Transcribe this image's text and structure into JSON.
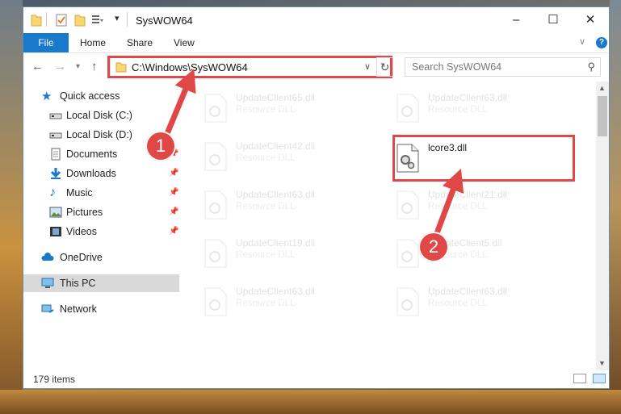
{
  "window": {
    "title": "SysWOW64",
    "controls": {
      "minimize": "–",
      "maximize": "☐",
      "close": "✕"
    }
  },
  "ribbon": {
    "file": "File",
    "tabs": [
      "Home",
      "Share",
      "View"
    ],
    "help": "?"
  },
  "address": {
    "path": "C:\\Windows\\SysWOW64",
    "search_placeholder": "Search SysWOW64"
  },
  "sidebar": {
    "items": [
      {
        "label": "Quick access",
        "icon": "star-icon",
        "pinned": false
      },
      {
        "label": "Local Disk (C:)",
        "icon": "drive-icon",
        "pinned": false
      },
      {
        "label": "Local Disk (D:)",
        "icon": "drive-icon",
        "pinned": false
      },
      {
        "label": "Documents",
        "icon": "documents-icon",
        "pinned": true
      },
      {
        "label": "Downloads",
        "icon": "download-icon",
        "pinned": true
      },
      {
        "label": "Music",
        "icon": "music-icon",
        "pinned": true
      },
      {
        "label": "Pictures",
        "icon": "pictures-icon",
        "pinned": true
      },
      {
        "label": "Videos",
        "icon": "videos-icon",
        "pinned": true
      },
      {
        "label": "OneDrive",
        "icon": "cloud-icon",
        "pinned": false
      },
      {
        "label": "This PC",
        "icon": "computer-icon",
        "pinned": false,
        "selected": true
      },
      {
        "label": "Network",
        "icon": "network-icon",
        "pinned": false
      }
    ]
  },
  "files": [
    {
      "name": "UpdateClient65.dll",
      "type": "Resource DLL"
    },
    {
      "name": "UpdateClient63.dll",
      "type": "Resource DLL"
    },
    {
      "name": "UpdateClient42.dll",
      "type": "Resource DLL"
    },
    {
      "name": "lcore3.dll",
      "type": ""
    },
    {
      "name": "UpdateClient63.dll",
      "type": "Resource DLL"
    },
    {
      "name": "UpdateClient21.dll",
      "type": "Resource DLL"
    },
    {
      "name": "UpdateClient19.dll",
      "type": "Resource DLL"
    },
    {
      "name": "UpdateClient5.dll",
      "type": "Resource DLL"
    },
    {
      "name": "UpdateClient63.dll",
      "type": "Resource DLL"
    },
    {
      "name": "UpdateClient63.dll",
      "type": "Resource DLL"
    }
  ],
  "status": {
    "item_count": "179 items"
  },
  "annotations": {
    "step1": "1",
    "step2": "2"
  },
  "colors": {
    "accent": "#1979ca",
    "highlight": "#e04848"
  }
}
